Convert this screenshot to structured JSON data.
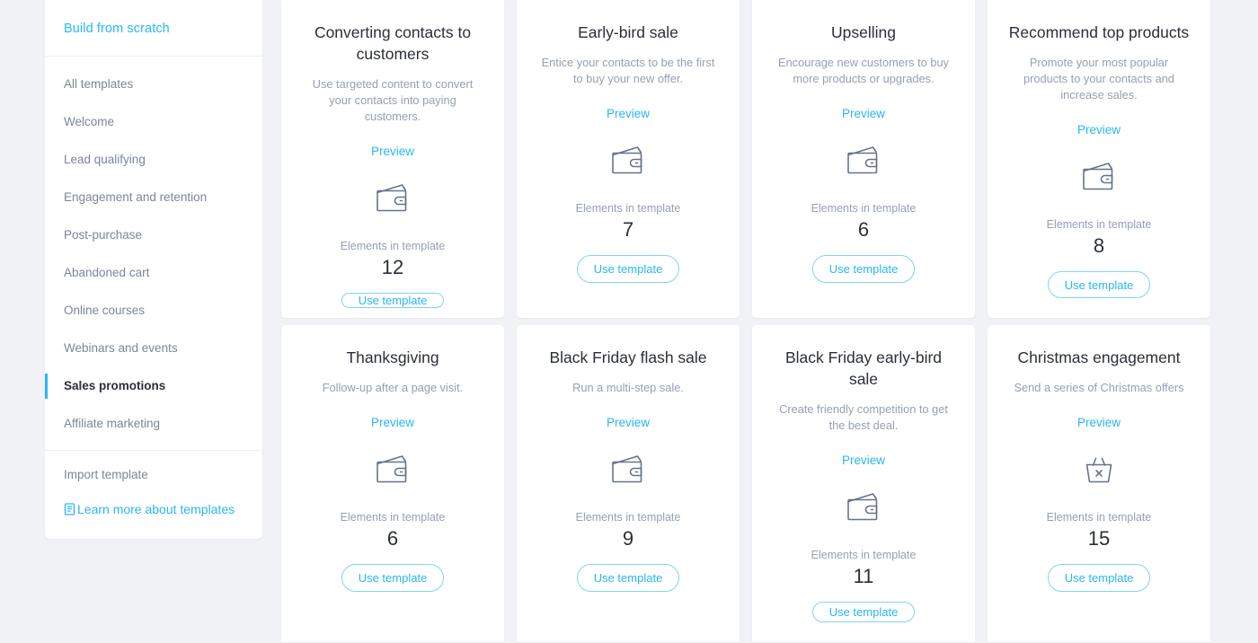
{
  "theme": {
    "accent": "#29b6f6",
    "background": "#f1f2f6",
    "card_background": "#ffffff",
    "text_primary": "#2b2f38",
    "text_muted": "#96a0b2",
    "icon_stroke": "#64748b"
  },
  "sidebar": {
    "build_from_scratch": "Build from scratch",
    "items": [
      {
        "label": "All templates",
        "active": false
      },
      {
        "label": "Welcome",
        "active": false
      },
      {
        "label": "Lead qualifying",
        "active": false
      },
      {
        "label": "Engagement and retention",
        "active": false
      },
      {
        "label": "Post-purchase",
        "active": false
      },
      {
        "label": "Abandoned cart",
        "active": false
      },
      {
        "label": "Online courses",
        "active": false
      },
      {
        "label": "Webinars and events",
        "active": false
      },
      {
        "label": "Sales promotions",
        "active": true
      },
      {
        "label": "Affiliate marketing",
        "active": false
      }
    ],
    "import_template": "Import template",
    "learn_more": "Learn more about templates",
    "learn_more_icon": "book-icon"
  },
  "labels": {
    "preview": "Preview",
    "elements_in_template": "Elements in template",
    "use_template": "Use template"
  },
  "cards": [
    {
      "title": "Converting contacts to customers",
      "description": "Use targeted content to convert your contacts into paying customers.",
      "icon": "wallet-icon",
      "elements_count": "12"
    },
    {
      "title": "Early-bird sale",
      "description": "Entice your contacts to be the first to buy your new offer.",
      "icon": "wallet-icon",
      "elements_count": "7"
    },
    {
      "title": "Upselling",
      "description": "Encourage new customers to buy more products or upgrades.",
      "icon": "wallet-icon",
      "elements_count": "6"
    },
    {
      "title": "Recommend top products",
      "description": "Promote your most popular products to your contacts and increase sales.",
      "icon": "wallet-icon",
      "elements_count": "8"
    },
    {
      "title": "Thanksgiving",
      "description": "Follow-up after a page visit.",
      "icon": "wallet-icon",
      "elements_count": "6"
    },
    {
      "title": "Black Friday flash sale",
      "description": "Run a multi-step sale.",
      "icon": "wallet-icon",
      "elements_count": "9"
    },
    {
      "title": "Black Friday early-bird sale",
      "description": "Create friendly competition to get the best deal.",
      "icon": "wallet-icon",
      "elements_count": "11"
    },
    {
      "title": "Christmas engagement",
      "description": "Send a series of Christmas offers",
      "icon": "basket-x-icon",
      "elements_count": "15"
    }
  ]
}
